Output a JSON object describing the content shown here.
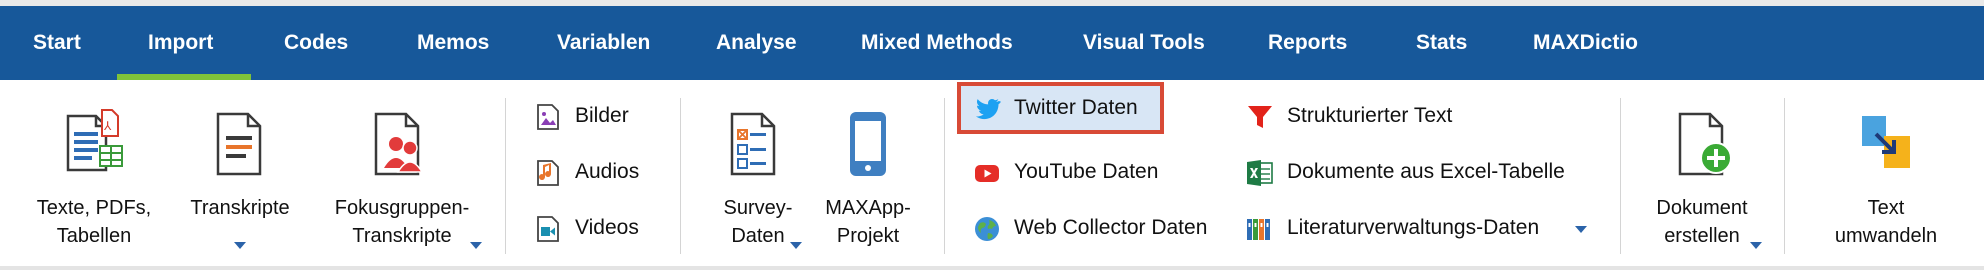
{
  "tabs": [
    {
      "label": "Start",
      "active": false
    },
    {
      "label": "Import",
      "active": true
    },
    {
      "label": "Codes",
      "active": false
    },
    {
      "label": "Memos",
      "active": false
    },
    {
      "label": "Variablen",
      "active": false
    },
    {
      "label": "Analyse",
      "active": false
    },
    {
      "label": "Mixed Methods",
      "active": false
    },
    {
      "label": "Visual Tools",
      "active": false
    },
    {
      "label": "Reports",
      "active": false
    },
    {
      "label": "Stats",
      "active": false
    },
    {
      "label": "MAXDictio",
      "active": false
    }
  ],
  "ribbon": {
    "texte": {
      "line1": "Texte, PDFs,",
      "line2": "Tabellen"
    },
    "transkripte": {
      "line1": "Transkripte"
    },
    "fokus": {
      "line1": "Fokusgruppen-",
      "line2": "Transkripte"
    },
    "media": {
      "bilder": "Bilder",
      "audios": "Audios",
      "videos": "Videos"
    },
    "survey": {
      "line1": "Survey-",
      "line2": "Daten"
    },
    "maxapp": {
      "line1": "MAXApp-",
      "line2": "Projekt"
    },
    "social": {
      "twitter": "Twitter Daten",
      "youtube": "YouTube Daten",
      "webcollector": "Web Collector Daten"
    },
    "structured": {
      "strukturiert": "Strukturierter Text",
      "excel": "Dokumente aus Excel-Tabelle",
      "literatur": "Literaturverwaltungs-Daten"
    },
    "dokument": {
      "line1": "Dokument",
      "line2": "erstellen"
    },
    "text": {
      "line1": "Text",
      "line2": "umwandeln"
    }
  },
  "colors": {
    "tabbar": "#17589a",
    "active_underline": "#7fc33a",
    "highlight_border": "#d84a36",
    "highlight_fill": "#d8e6f5"
  }
}
